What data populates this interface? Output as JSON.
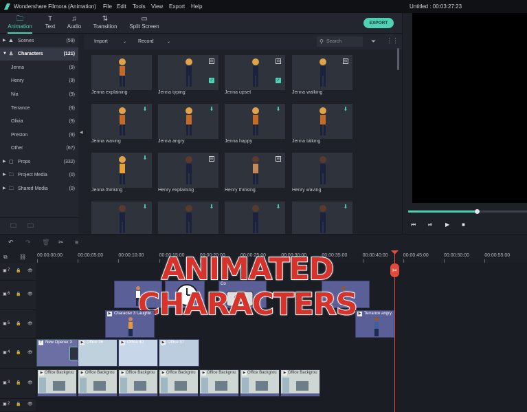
{
  "titlebar": {
    "app_title": "Wondershare Filmora (Animation)",
    "menus": [
      "File",
      "Edit",
      "Tools",
      "View",
      "Export",
      "Help"
    ],
    "doc_title": "Untitled : 00:03:27:23"
  },
  "toolbar": {
    "tabs": [
      {
        "label": "Animation",
        "icon": "folder-icon"
      },
      {
        "label": "Text",
        "icon": "text-icon"
      },
      {
        "label": "Audio",
        "icon": "music-note-icon"
      },
      {
        "label": "Transition",
        "icon": "transition-icon"
      },
      {
        "label": "Split Screen",
        "icon": "split-screen-icon"
      }
    ],
    "export_label": "EXPORT"
  },
  "sidebar": {
    "items": [
      {
        "label": "Scenes",
        "count": "(59)"
      },
      {
        "label": "Characters",
        "count": "(121)"
      },
      {
        "label": "Jenna",
        "count": "(9)"
      },
      {
        "label": "Henry",
        "count": "(9)"
      },
      {
        "label": "Nia",
        "count": "(9)"
      },
      {
        "label": "Terrance",
        "count": "(9)"
      },
      {
        "label": "Olivia",
        "count": "(9)"
      },
      {
        "label": "Preston",
        "count": "(9)"
      },
      {
        "label": "Other",
        "count": "(67)"
      },
      {
        "label": "Props",
        "count": "(332)"
      },
      {
        "label": "Project Media",
        "count": "(0)"
      },
      {
        "label": "Shared Media",
        "count": "(0)"
      }
    ]
  },
  "media_bar": {
    "import_label": "Import",
    "record_label": "Record",
    "search_placeholder": "Search"
  },
  "media": {
    "cards": [
      {
        "label": "Jenna explaining",
        "badge": ""
      },
      {
        "label": "Jenna typing",
        "badge": "film,check"
      },
      {
        "label": "Jenna upset",
        "badge": "film,check"
      },
      {
        "label": "Jenna walking",
        "badge": "film"
      },
      {
        "label": "Jenna waving",
        "badge": "download"
      },
      {
        "label": "Jenna angry",
        "badge": "download"
      },
      {
        "label": "Jenna happy",
        "badge": "download"
      },
      {
        "label": "Jenna talking",
        "badge": "download"
      },
      {
        "label": "Jenna thinking",
        "badge": "download"
      },
      {
        "label": "Henry explaining",
        "badge": "film"
      },
      {
        "label": "Henry thinking",
        "badge": "film"
      },
      {
        "label": "Henry waving",
        "badge": ""
      },
      {
        "label": "",
        "badge": "download"
      },
      {
        "label": "",
        "badge": "download"
      },
      {
        "label": "",
        "badge": "download"
      },
      {
        "label": "",
        "badge": "download"
      }
    ]
  },
  "timeline": {
    "ruler": [
      "00:00:00:00",
      "00:00:05:00",
      "00:00:10:00",
      "00:00:15:00",
      "00:00:20:00",
      "00:00:25:00",
      "00:00:30:00",
      "00:00:35:00",
      "00:00:40:00",
      "00:00:45:00",
      "00:00:50:00",
      "00:00:55:00"
    ],
    "overlay_title": "ANIMATED CHARACTERS",
    "track_numbers": [
      "7",
      "6",
      "5",
      "4",
      "3",
      "2"
    ],
    "clips": {
      "co": "Co",
      "character_laughing": "Character 3 Laughin",
      "terrance_angry": "Terrance angry",
      "new_opener": "New Opener 3",
      "office36": "Office 36",
      "office40": "Office 40",
      "office37": "Office 37",
      "office_bg": "Office Backgrou"
    }
  },
  "colors": {
    "accent": "#4fd1b5",
    "playhead": "#e24a3b",
    "clip_purple": "#5b5f97"
  }
}
